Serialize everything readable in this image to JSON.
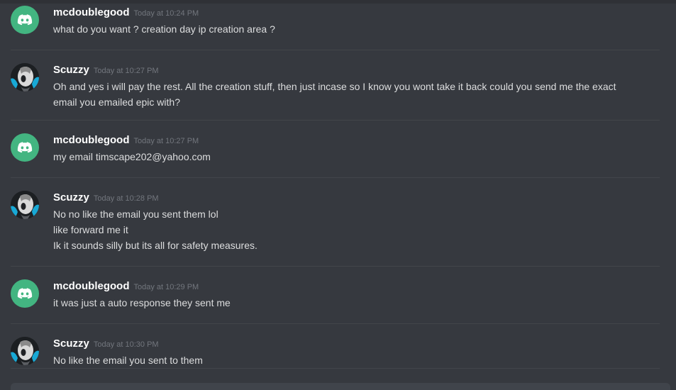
{
  "messages": [
    {
      "username": "mcdoublegood",
      "avatar": "discord-logo-icon",
      "timestamp": "Today at 10:24 PM",
      "lines": [
        "what do you want ? creation day ip creation area ?"
      ]
    },
    {
      "username": "Scuzzy",
      "avatar": "scuzzy-avatar",
      "timestamp": "Today at 10:27 PM",
      "lines": [
        "Oh and yes i will pay the rest. All the creation stuff, then just incase so I know you wont take it back could you send me the exact",
        "email you emailed epic with?"
      ]
    },
    {
      "username": "mcdoublegood",
      "avatar": "discord-logo-icon",
      "timestamp": "Today at 10:27 PM",
      "lines": [
        "my email timscape202@yahoo.com"
      ]
    },
    {
      "username": "Scuzzy",
      "avatar": "scuzzy-avatar",
      "timestamp": "Today at 10:28 PM",
      "lines": [
        "No no like the email you sent them lol",
        "like forward me it",
        "Ik it sounds silly but its all for safety measures."
      ]
    },
    {
      "username": "mcdoublegood",
      "avatar": "discord-logo-icon",
      "timestamp": "Today at 10:29 PM",
      "lines": [
        "it was just a auto response they sent me"
      ]
    },
    {
      "username": "Scuzzy",
      "avatar": "scuzzy-avatar",
      "timestamp": "Today at 10:30 PM",
      "lines": [
        "No like the email you sent to them"
      ]
    }
  ],
  "colors": {
    "background": "#36393f",
    "username": "#ffffff",
    "timestamp": "#72767d",
    "message_text": "#dcddde",
    "discord_avatar": "#43b581"
  }
}
